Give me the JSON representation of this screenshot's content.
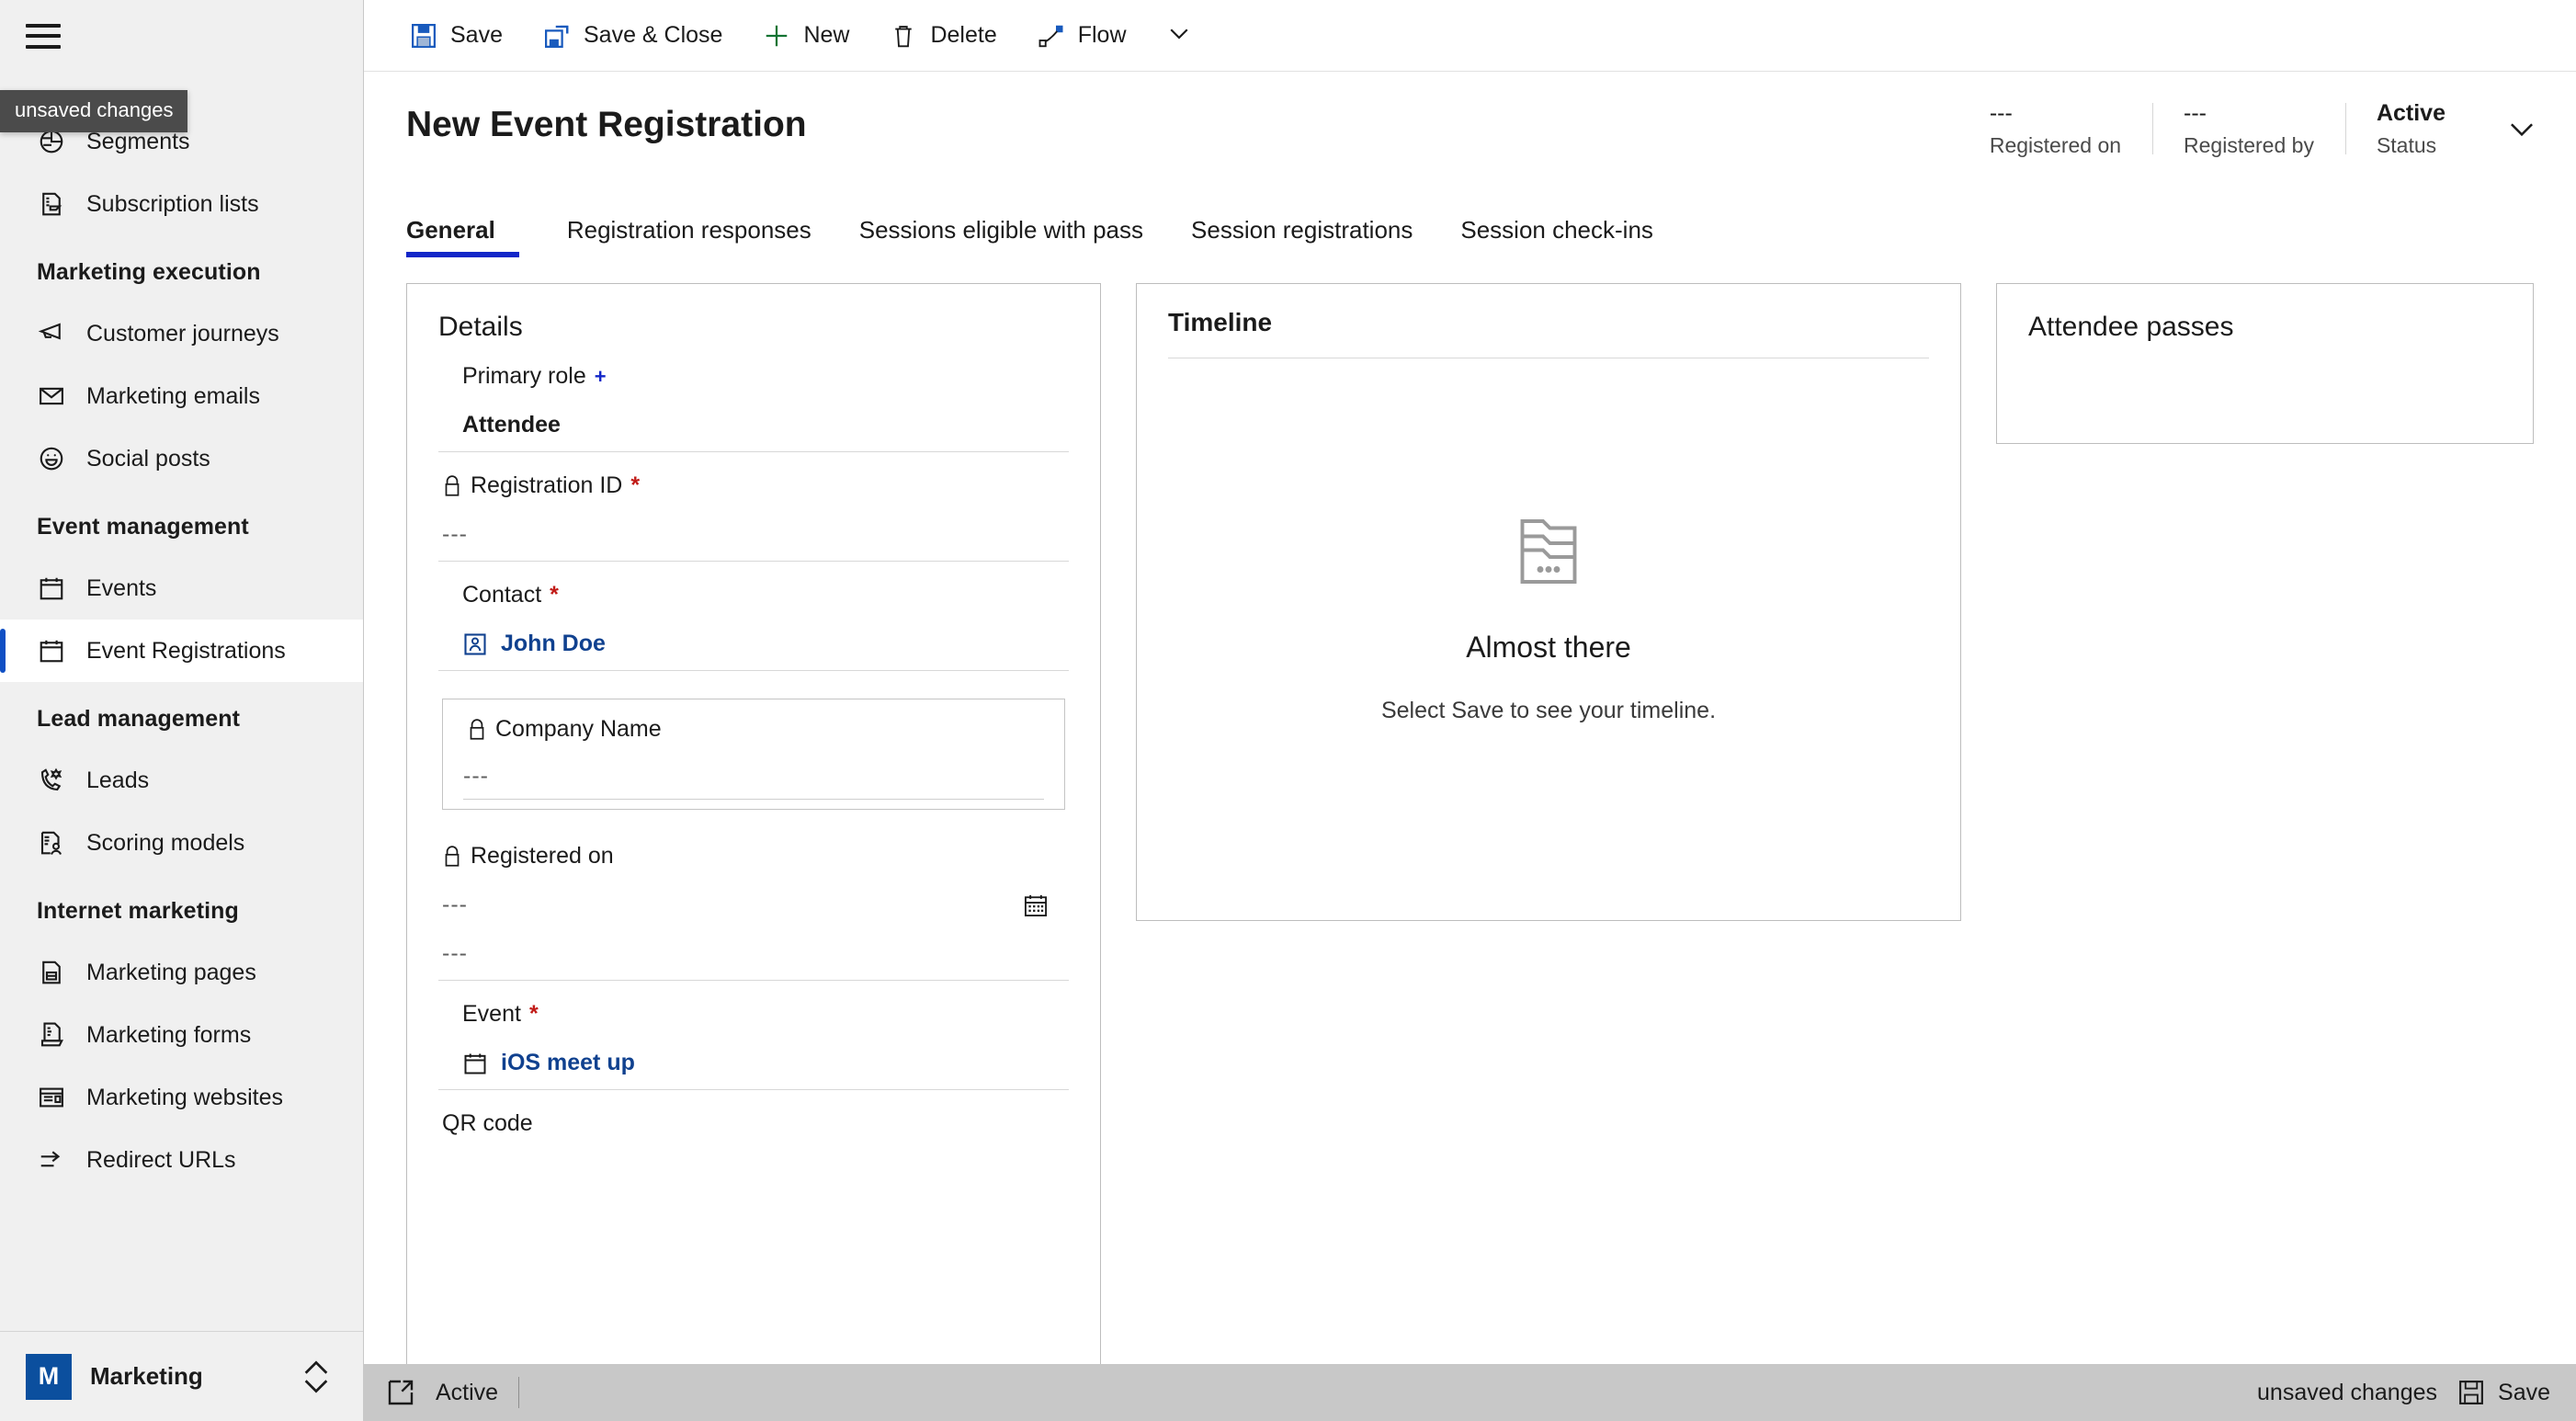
{
  "sidebar": {
    "hamburger_label": "Site map",
    "tooltip": "unsaved changes",
    "groups": [
      {
        "title": "",
        "items": [
          {
            "label": "Segments",
            "icon": "segments-icon",
            "active": false
          },
          {
            "label": "Subscription lists",
            "icon": "subscription-lists-icon",
            "active": false
          }
        ]
      },
      {
        "title": "Marketing execution",
        "items": [
          {
            "label": "Customer journeys",
            "icon": "megaphone-icon",
            "active": false
          },
          {
            "label": "Marketing emails",
            "icon": "envelope-icon",
            "active": false
          },
          {
            "label": "Social posts",
            "icon": "smiley-icon",
            "active": false
          }
        ]
      },
      {
        "title": "Event management",
        "items": [
          {
            "label": "Events",
            "icon": "calendar-icon",
            "active": false
          },
          {
            "label": "Event Registrations",
            "icon": "calendar-icon",
            "active": true
          }
        ]
      },
      {
        "title": "Lead management",
        "items": [
          {
            "label": "Leads",
            "icon": "lead-phone-icon",
            "active": false
          },
          {
            "label": "Scoring models",
            "icon": "scoring-models-icon",
            "active": false
          }
        ]
      },
      {
        "title": "Internet marketing",
        "items": [
          {
            "label": "Marketing pages",
            "icon": "marketing-page-icon",
            "active": false
          },
          {
            "label": "Marketing forms",
            "icon": "marketing-form-icon",
            "active": false
          },
          {
            "label": "Marketing websites",
            "icon": "marketing-website-icon",
            "active": false
          },
          {
            "label": "Redirect URLs",
            "icon": "redirect-icon",
            "active": false
          }
        ]
      }
    ],
    "app_switcher": {
      "badge": "M",
      "name": "Marketing"
    }
  },
  "commandbar": {
    "save": "Save",
    "save_close": "Save & Close",
    "new": "New",
    "delete": "Delete",
    "flow": "Flow",
    "overflow": "More commands"
  },
  "header": {
    "title": "New Event Registration",
    "fields": [
      {
        "value": "---",
        "label": "Registered on",
        "bold": false
      },
      {
        "value": "---",
        "label": "Registered by",
        "bold": false
      },
      {
        "value": "Active",
        "label": "Status",
        "bold": true
      }
    ]
  },
  "tabs": [
    {
      "label": "General",
      "active": true
    },
    {
      "label": "Registration responses",
      "active": false
    },
    {
      "label": "Sessions eligible with pass",
      "active": false
    },
    {
      "label": "Session registrations",
      "active": false
    },
    {
      "label": "Session check-ins",
      "active": false
    }
  ],
  "details": {
    "title": "Details",
    "primary_role": {
      "label": "Primary role",
      "marker": "+",
      "value": "Attendee"
    },
    "registration_id": {
      "label": "Registration ID",
      "marker": "*",
      "value": "---",
      "locked": true
    },
    "contact": {
      "label": "Contact",
      "marker": "*",
      "value": "John Doe"
    },
    "company_name": {
      "label": "Company Name",
      "value": "---",
      "locked": true
    },
    "registered_on": {
      "label": "Registered on",
      "date_value": "---",
      "time_value": "---",
      "locked": true
    },
    "event": {
      "label": "Event",
      "marker": "*",
      "value": "iOS meet up"
    },
    "qr_code": {
      "label": "QR code"
    }
  },
  "timeline": {
    "title": "Timeline",
    "empty_title": "Almost there",
    "empty_sub": "Select Save to see your timeline."
  },
  "passes": {
    "title": "Attendee passes"
  },
  "statusbar": {
    "status": "Active",
    "unsaved": "unsaved changes",
    "save": "Save"
  },
  "colors": {
    "accent": "#1226c8",
    "link": "#10418f",
    "required": "#c11b17",
    "app_badge": "#0b4f9e",
    "sidebar_bg": "#f0f0f0",
    "statusbar_bg": "#c8c8c8"
  }
}
